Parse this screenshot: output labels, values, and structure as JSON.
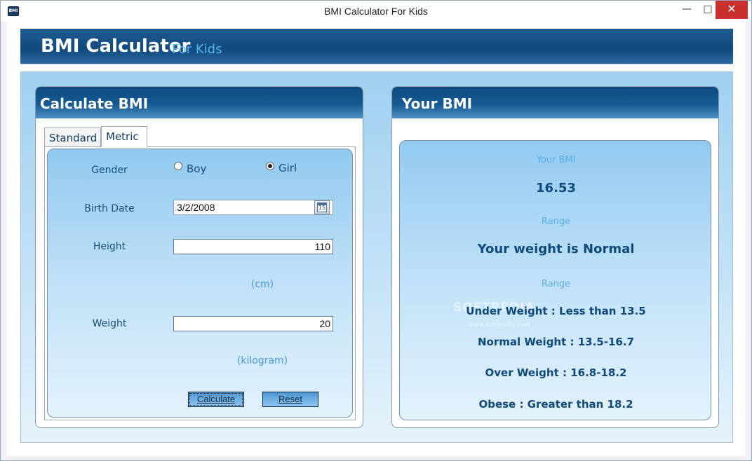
{
  "window": {
    "title": "BMI Calculator For Kids",
    "icon_name": "app-icon",
    "icon_text": "BMI",
    "minimize_glyph": "—",
    "maximize_glyph": "□",
    "close_glyph": "✕"
  },
  "banner": {
    "title": "BMI Calculator",
    "subtitle": "For Kids"
  },
  "calculate_panel": {
    "title": "Calculate BMI",
    "tabs": [
      {
        "label": "Standard",
        "active": false
      },
      {
        "label": "Metric",
        "active": true
      }
    ],
    "gender": {
      "label": "Gender",
      "options": [
        {
          "label": "Boy",
          "checked": false
        },
        {
          "label": "Girl",
          "checked": true
        }
      ]
    },
    "birth_date": {
      "label": "Birth Date",
      "value": "3/2/2008",
      "calendar_day": "15"
    },
    "height": {
      "label": "Height",
      "value": "110",
      "unit": "(cm)"
    },
    "weight": {
      "label": "Weight",
      "value": "20",
      "unit": "(kilogram)"
    },
    "buttons": {
      "calculate": "Calculate",
      "reset": "Reset"
    }
  },
  "result_panel": {
    "title": "Your BMI",
    "bmi_caption": "Your BMI",
    "bmi_value": "16.53",
    "range_caption": "Range",
    "status": "Your weight is Normal",
    "ranges_caption": "Range",
    "ranges": [
      "Under Weight : Less than 13.5",
      "Normal Weight : 13.5-16.7",
      "Over Weight : 16.8-18.2",
      "Obese : Greater than 18.2"
    ]
  },
  "watermark": {
    "text": "SOFTPEDIA",
    "url": "www.softpedia.com"
  },
  "colors": {
    "banner": "#114a7d",
    "panel_header": "#155a93",
    "accent_text": "#0f4a7a",
    "caption_text": "#5aaee6",
    "close_button": "#c7302c"
  }
}
